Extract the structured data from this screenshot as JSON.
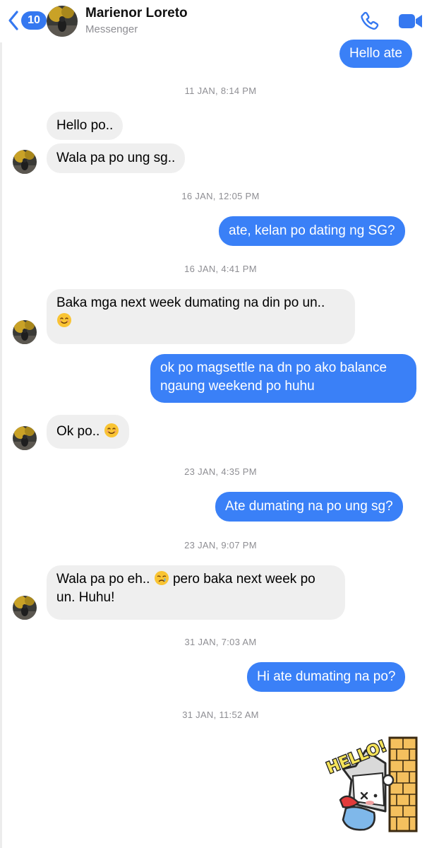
{
  "header": {
    "back_count": "10",
    "contact_name": "Marienor Loreto",
    "subtitle": "Messenger"
  },
  "messages": [
    {
      "type": "outgoing",
      "text": "Hello ate"
    },
    {
      "type": "timestamp",
      "text": "11 JAN, 8:14 PM"
    },
    {
      "type": "incoming",
      "text": "Hello po.."
    },
    {
      "type": "incoming",
      "text": "Wala pa po ung sg.."
    },
    {
      "type": "timestamp",
      "text": "16 JAN, 12:05 PM"
    },
    {
      "type": "outgoing",
      "text": "ate, kelan po dating ng SG?"
    },
    {
      "type": "timestamp",
      "text": "16 JAN, 4:41 PM"
    },
    {
      "type": "incoming",
      "text": "Baka mga next week dumating na din po un..",
      "emoji": "smiling-face"
    },
    {
      "type": "outgoing",
      "line1": "ok po magsettle na dn po ako balance",
      "line2": "ngaung weekend po huhu"
    },
    {
      "type": "incoming",
      "text": "Ok po..",
      "emoji": "smiling-face"
    },
    {
      "type": "timestamp",
      "text": "23 JAN, 4:35 PM"
    },
    {
      "type": "outgoing",
      "text": "Ate dumating na po ung sg?"
    },
    {
      "type": "timestamp",
      "text": "23 JAN, 9:07 PM"
    },
    {
      "type": "incoming",
      "text_before": "Wala pa po eh..",
      "emoji": "crying-face",
      "text_after": "pero baka next week po",
      "line2": "un. Huhu!"
    },
    {
      "type": "timestamp",
      "text": "31 JAN, 7:03 AM"
    },
    {
      "type": "outgoing",
      "text": "Hi ate dumating na po?"
    },
    {
      "type": "timestamp",
      "text": "31 JAN, 11:52 AM"
    },
    {
      "type": "sticker",
      "text": "HELLO!",
      "icon": "hello-sticker"
    }
  ],
  "colors": {
    "outgoing_bubble": "#3a80f7",
    "incoming_bubble": "#efefef",
    "accent": "#3578f0",
    "timestamp": "#8e8e93"
  }
}
